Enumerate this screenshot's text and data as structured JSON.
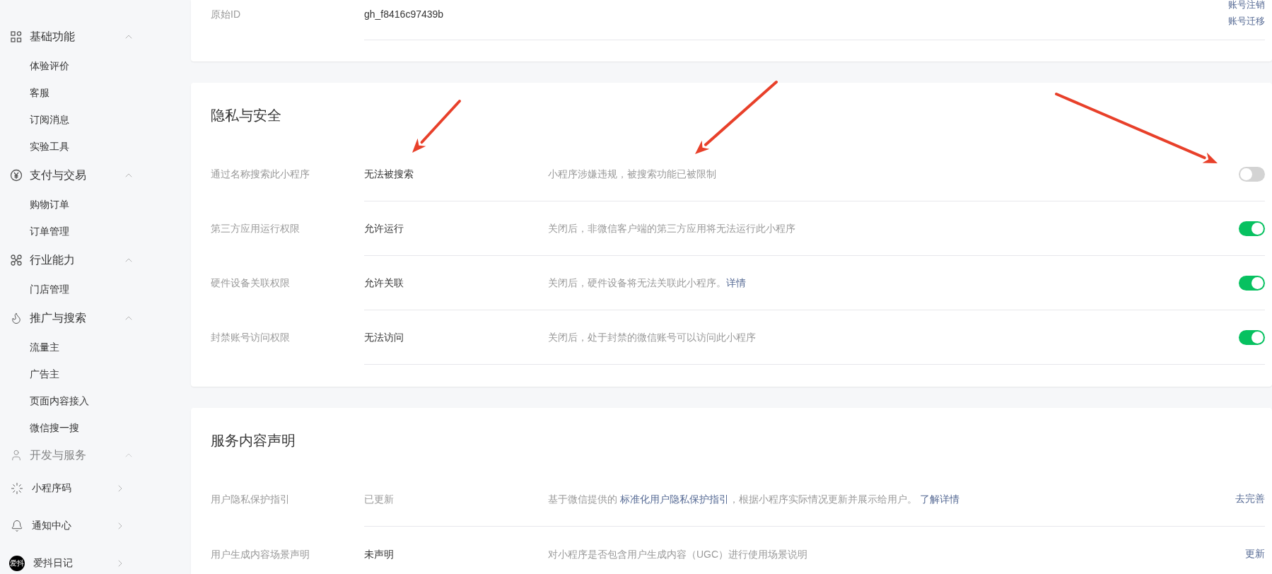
{
  "sidebar": {
    "groups": [
      {
        "label": "基础功能",
        "expanded": true,
        "faded": false,
        "items": [
          "体验评价",
          "客服",
          "订阅消息",
          "实验工具"
        ]
      },
      {
        "label": "支付与交易",
        "expanded": true,
        "faded": false,
        "items": [
          "购物订单",
          "订单管理"
        ]
      },
      {
        "label": "行业能力",
        "expanded": true,
        "faded": false,
        "items": [
          "门店管理"
        ]
      },
      {
        "label": "推广与搜索",
        "expanded": true,
        "faded": false,
        "items": [
          "流量主",
          "广告主",
          "页面内容接入",
          "微信搜一搜"
        ]
      },
      {
        "label": "开发与服务",
        "expanded": true,
        "faded": true
      }
    ],
    "bottom_items": [
      {
        "label": "小程序码"
      },
      {
        "label": "通知中心"
      },
      {
        "avatar_text": "爱抖",
        "label": "爱抖日记"
      }
    ]
  },
  "account_card": {
    "label": "原始ID",
    "value": "gh_f8416c97439b",
    "links": [
      "账号注销",
      "账号迁移"
    ]
  },
  "privacy": {
    "title": "隐私与安全",
    "rows": [
      {
        "label": "通过名称搜索此小程序",
        "value": "无法被搜索",
        "description": [
          {
            "text": "小程序涉嫌违规，被搜索功能已被限制",
            "kind": "text"
          }
        ],
        "on": false
      },
      {
        "label": "第三方应用运行权限",
        "value": "允许运行",
        "description": [
          {
            "text": "关闭后，非微信客户端的第三方应用将无法运行此小程序",
            "kind": "text"
          }
        ],
        "on": true
      },
      {
        "label": "硬件设备关联权限",
        "value": "允许关联",
        "description": [
          {
            "text": "关闭后，硬件设备将无法关联此小程序。",
            "kind": "text"
          },
          {
            "text": "详情",
            "kind": "link"
          }
        ],
        "on": true
      },
      {
        "label": "封禁账号访问权限",
        "value": "无法访问",
        "description": [
          {
            "text": "关闭后，处于封禁的微信账号可以访问此小程序",
            "kind": "text"
          }
        ],
        "on": true
      }
    ]
  },
  "service": {
    "title": "服务内容声明",
    "rows": [
      {
        "label": "用户隐私保护指引",
        "value": "已更新",
        "muted": true,
        "description": [
          {
            "text": "基于微信提供的 ",
            "kind": "text"
          },
          {
            "text": "标准化用户隐私保护指引",
            "kind": "link"
          },
          {
            "text": "，根据小程序实际情况更新并展示给用户。 ",
            "kind": "text"
          },
          {
            "text": "了解详情",
            "kind": "link"
          }
        ],
        "action": "去完善"
      },
      {
        "label": "用户生成内容场景声明",
        "value": "未声明",
        "muted": false,
        "description": [
          {
            "text": "对小程序是否包含用户生成内容（UGC）进行使用场景说明",
            "kind": "text"
          }
        ],
        "action": "更新"
      }
    ]
  }
}
